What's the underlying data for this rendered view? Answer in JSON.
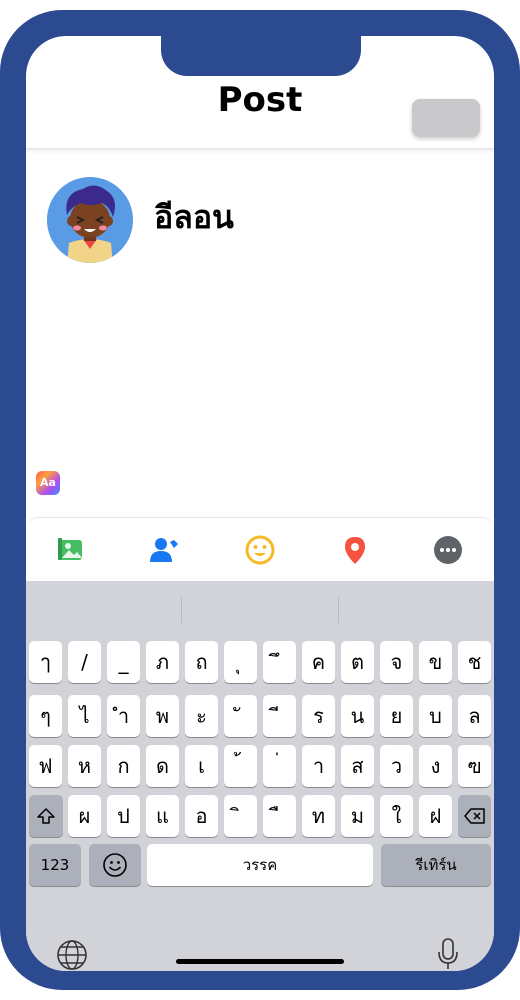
{
  "header": {
    "title": "Post",
    "post_button_label": ""
  },
  "user": {
    "name": "อีลอน"
  },
  "composer": {
    "text_style_label": "Aa"
  },
  "toolbar": {
    "items": [
      {
        "icon": "photo-icon",
        "color": "#45bd62"
      },
      {
        "icon": "tag-people-icon",
        "color": "#1877f2"
      },
      {
        "icon": "feeling-icon",
        "color": "#f7b928"
      },
      {
        "icon": "location-icon",
        "color": "#f5533d"
      },
      {
        "icon": "more-icon",
        "color": "#5f6368"
      }
    ]
  },
  "keyboard": {
    "rows": [
      [
        "ๅ",
        "/",
        "_",
        "ภ",
        "ถ",
        "ุ",
        "ึ",
        "ค",
        "ต",
        "จ",
        "ข",
        "ช"
      ],
      [
        "ๆ",
        "ไ",
        "ำ",
        "พ",
        "ะ",
        "ั",
        "ี",
        "ร",
        "น",
        "ย",
        "บ",
        "ล"
      ],
      [
        "ฟ",
        "ห",
        "ก",
        "ด",
        "เ",
        "้",
        "่",
        "า",
        "ส",
        "ว",
        "ง",
        "ฃ"
      ],
      [
        "ผ",
        "ป",
        "แ",
        "อ",
        "ิ",
        "ื",
        "ท",
        "ม",
        "ใ",
        "ฝ"
      ]
    ],
    "numbers_label": "123",
    "space_label": "วรรค",
    "return_label": "รีเทิร์น"
  }
}
